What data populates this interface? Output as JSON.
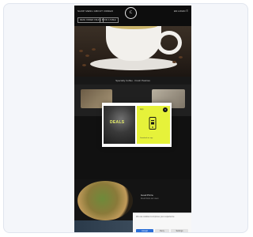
{
  "nav": {
    "left": "SHOP MENU ABOUT ORDER",
    "right": "EN  LOGIN  ☰",
    "logo": "C",
    "pill1": "MENU ORDER ONLINE",
    "pill2": "BOOK A TABLE"
  },
  "hero": {
    "caption": "Specialty Coffee · Fresh Pastries"
  },
  "modal": {
    "headline": "DEALS",
    "brand": "App",
    "close": "×",
    "caption": "Download our app"
  },
  "promo": {
    "title": "Good Pizza",
    "text": "Fresh from our oven"
  },
  "cookie": {
    "text": "We use cookies to improve your experience.",
    "accept": "Accept",
    "deny": "Deny",
    "settings": "Settings"
  },
  "colors": {
    "accent": "#e6f23a",
    "page_bg": "#141414",
    "cookie_primary": "#2c6fd6"
  }
}
